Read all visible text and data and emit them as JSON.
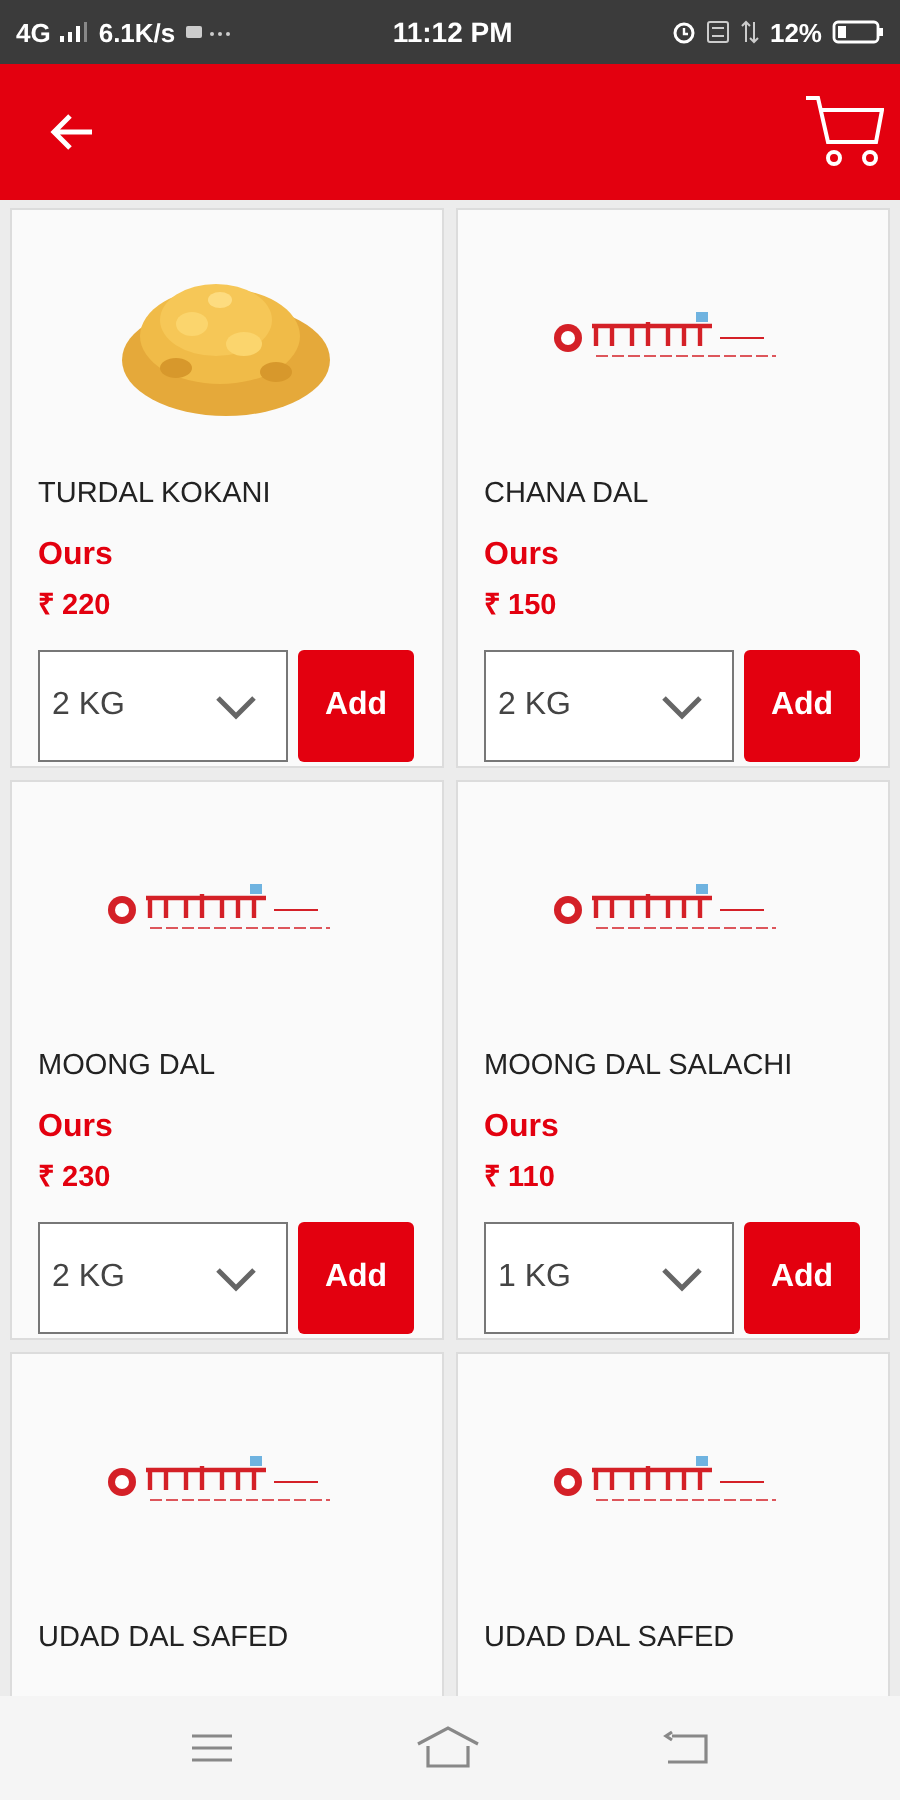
{
  "status_bar": {
    "network": "4G",
    "speed": "6.1K/s",
    "time": "11:12 PM",
    "battery": "12%"
  },
  "products": [
    {
      "kind": "picture",
      "name": "TURDAL KOKANI",
      "label": "Ours",
      "price": "₹ 220",
      "quantity": "2 KG",
      "button": "Add"
    },
    {
      "kind": "logo",
      "name": "CHANA DAL",
      "label": "Ours",
      "price": "₹ 150",
      "quantity": "2 KG",
      "button": "Add"
    },
    {
      "kind": "logo",
      "name": "MOONG DAL",
      "label": "Ours",
      "price": "₹ 230",
      "quantity": "2 KG",
      "button": "Add"
    },
    {
      "kind": "logo",
      "name": "MOONG DAL SALACHI",
      "label": "Ours",
      "price": "₹ 110",
      "quantity": "1 KG",
      "button": "Add"
    },
    {
      "kind": "logo",
      "name": "UDAD DAL SAFED"
    },
    {
      "kind": "logo",
      "name": "UDAD DAL SAFED"
    }
  ]
}
